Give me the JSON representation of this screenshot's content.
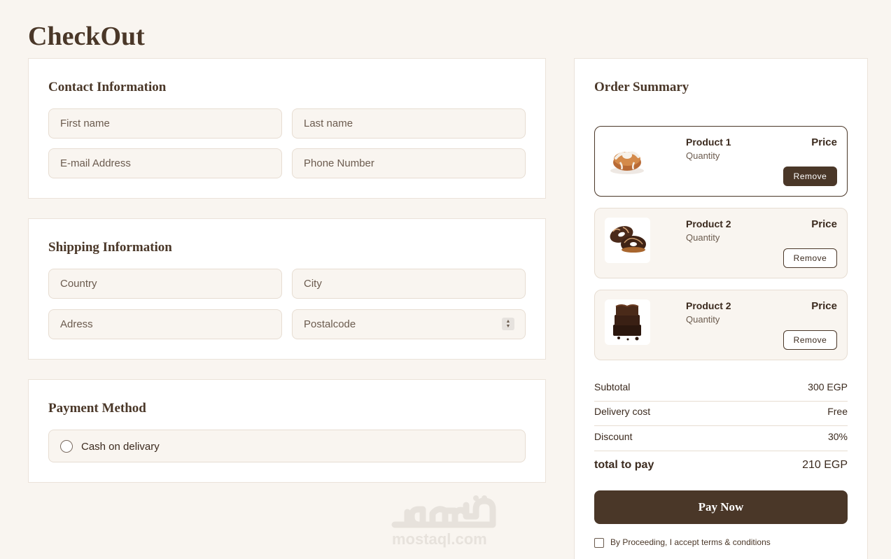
{
  "page": {
    "title": "CheckOut"
  },
  "contact": {
    "title": "Contact Information",
    "first_name_placeholder": "First name",
    "last_name_placeholder": "Last name",
    "email_placeholder": "E-mail Address",
    "phone_placeholder": "Phone Number"
  },
  "shipping": {
    "title": "Shipping Information",
    "country_placeholder": "Country",
    "city_placeholder": "City",
    "address_placeholder": "Adress",
    "postal_placeholder": "Postalcode"
  },
  "payment": {
    "title": "Payment Method",
    "option_label": "Cash on delivary"
  },
  "summary": {
    "title": "Order Summary",
    "products": [
      {
        "name": "Product 1",
        "quantity": "Quantity",
        "price": "Price",
        "remove_label": "Remove",
        "image_icon": "cinnamon-roll-icon",
        "selected": true
      },
      {
        "name": "Product 2",
        "quantity": "Quantity",
        "price": "Price",
        "remove_label": "Remove",
        "image_icon": "donuts-icon",
        "selected": false
      },
      {
        "name": "Product 2",
        "quantity": "Quantity",
        "price": "Price",
        "remove_label": "Remove",
        "image_icon": "brownie-icon",
        "selected": false
      }
    ],
    "subtotal_label": "Subtotal",
    "subtotal_value": "300 EGP",
    "delivery_label": "Delivery cost",
    "delivery_value": "Free",
    "discount_label": "Discount",
    "discount_value": "30%",
    "total_label": "total to pay",
    "total_value": "210 EGP",
    "pay_button": "Pay Now",
    "terms_label": "By Proceeding, I accept terms & conditions"
  },
  "watermark": {
    "text": "mostaql.com"
  },
  "colors": {
    "background": "#f9f5f0",
    "brand_brown": "#4a3728",
    "field_bg": "#f9f5f0",
    "border": "#e7ddd2"
  }
}
